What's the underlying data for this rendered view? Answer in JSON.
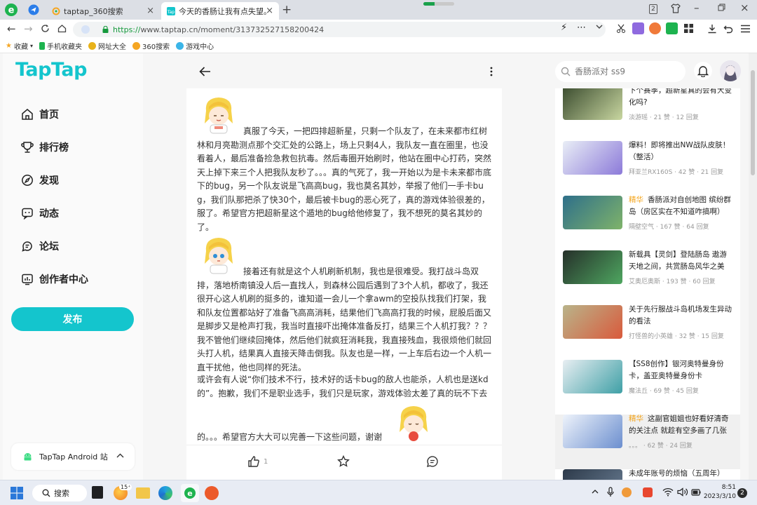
{
  "browser": {
    "tabs": [
      {
        "label": "taptap_360搜索",
        "active": false
      },
      {
        "label": "今天的香肠让我有点失望。",
        "active": true
      }
    ],
    "tab_badge": "2",
    "url_scheme": "https://",
    "url_rest": "www.taptap.cn/moment/313732527158200424",
    "load_progress": 0.36,
    "bookmarks": [
      "收藏",
      "手机收藏夹",
      "网址大全",
      "360搜索",
      "游戏中心"
    ]
  },
  "sidebar": {
    "brand": "TapTap",
    "nav": [
      {
        "label": "首页",
        "icon": "home-icon"
      },
      {
        "label": "排行榜",
        "icon": "trophy-icon"
      },
      {
        "label": "发现",
        "icon": "compass-icon"
      },
      {
        "label": "动态",
        "icon": "chat-square-icon"
      },
      {
        "label": "论坛",
        "icon": "forum-icon"
      },
      {
        "label": "创作者中心",
        "icon": "creator-icon"
      }
    ],
    "publish_label": "发布",
    "android_label": "TapTap Android 站"
  },
  "post": {
    "paragraphs": [
      "真服了今天，一把四排超新星，只剩一个队友了，在未来都市红树林和月亮勘测点那个交汇处的公路上，场上只剩4人，我队友一直在圈里，也没看着人，最后准备捡急救包抗毒。然后毒圈开始刷时，他站在圈中心打药，突然天上掉下来三个人把我队友秒了。。。真的气死了，我一开始以为是卡未来都市底下的bug，另一个队友说是飞高高bug，我也莫名其妙，举报了他们一手卡bug，我们队那把杀了快30个，最后被卡bug的恶心死了，真的游戏体验很差的，服了。希望官方把超新星这个遁地的bug给他修复了，我不想死的莫名其妙的了。",
      "接着还有就是这个人机刷新机制，我也是很难受。我打战斗岛双排，落地桥南镇没人后一直找人，到森林公园后遇到了3个人机，都收了，我还很开心这人机刷的挺多的，谁知道一会儿一个拿awm的空投队找我们打架，我和队友位置都站好了准备飞高高消耗，结果他们飞高高打我的时候，屁股后面又是脚步又是枪声打我，我当时直接吓出掩体准备反打，结果三个人机打我？？？我不管他们继续回掩体，然后他们就疯狂消耗我，我直接残血，我很烦他们就回头打人机，结果真人直接天降击倒我。队友也是一样，一上车后右边一个人机一直干扰他，他也同样的死法。",
      "或许会有人说“你们技术不行，技术好的话卡bug的敌人也能杀，人机也是送kd的”。抱歉，我们不是职业选手，我们只是玩家，游戏体验太差了真的玩不下去",
      "的。。。希望官方大大可以完善一下这些问题，谢谢"
    ],
    "like_count": "1"
  },
  "search": {
    "placeholder": "香肠派对 ss9"
  },
  "related": [
    {
      "tag": "",
      "title": "下个赛季，超新星真的会有大变化吗?",
      "author": "淡游瑶",
      "likes": "21 赞",
      "replies": "12 回复",
      "thumb_colors": [
        "#3b4c2f",
        "#c8d6a0"
      ]
    },
    {
      "tag": "",
      "title": "爆料！即将推出NW战队皮肤！（整活）",
      "author": "拜亚兰RX160S",
      "likes": "42 赞",
      "replies": "21 回复",
      "thumb_colors": [
        "#e9eef6",
        "#8c7ad9"
      ]
    },
    {
      "tag": "精华",
      "title": "香肠派对自创地图 缤纷群岛（房区实在不知道咋搞啊）",
      "author": "隔壁空气",
      "likes": "167 赞",
      "replies": "64 回复",
      "thumb_colors": [
        "#2e6f8a",
        "#7fb36a"
      ]
    },
    {
      "tag": "",
      "title": "新载具【灵剑】登陆肠岛 遨游天地之间，共赏肠岛风华之美",
      "author": "艾奥厄奥斯",
      "likes": "193 赞",
      "replies": "60 回复",
      "thumb_colors": [
        "#26302a",
        "#4ea660"
      ]
    },
    {
      "tag": "",
      "title": "关于先行服战斗岛机场发生异动的看法",
      "author": "打怪兽的小英雄",
      "likes": "32 赞",
      "replies": "15 回复",
      "thumb_colors": [
        "#b9b48a",
        "#d95a3c"
      ]
    },
    {
      "tag": "",
      "title": "【SS8创作】银河奥特曼身份卡，盖亚奥特曼身份卡",
      "author": "魔法丘",
      "likes": "69 赞",
      "replies": "45 回复",
      "thumb_colors": [
        "#e8eef2",
        "#3fa0a6"
      ]
    },
    {
      "tag": "精华",
      "title": "这副官姐姐也好看好清奇的关注点 就趁有空多画了几张",
      "author": "。。。",
      "likes": "62 赞",
      "replies": "24 回复",
      "thumb_colors": [
        "#eef3fb",
        "#6c8fcf"
      ]
    },
    {
      "tag": "",
      "title": "未成年账号的烦恼（五周年）",
      "author": "",
      "likes": "",
      "replies": "",
      "thumb_colors": [
        "#2d3a4a",
        "#6b7f95"
      ]
    }
  ],
  "taskbar": {
    "search_label": "搜索",
    "mail_badge": "15⁺",
    "time": "8:51",
    "date": "2023/3/10",
    "notifications": "2"
  }
}
